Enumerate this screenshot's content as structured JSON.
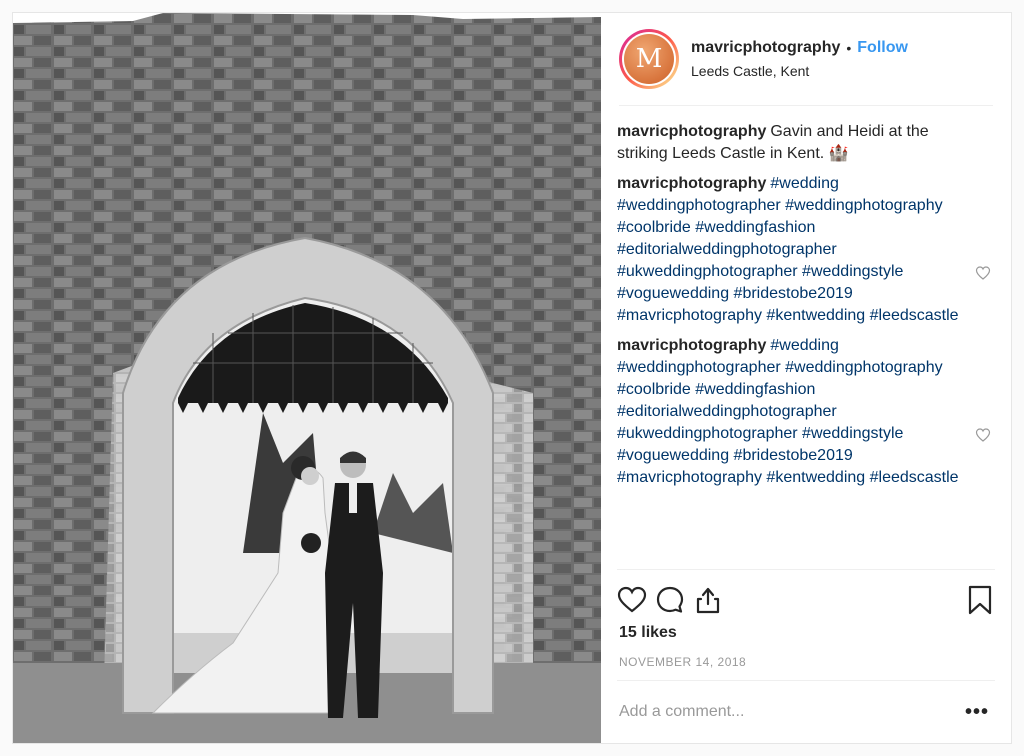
{
  "post": {
    "username": "mavricphotography",
    "separator": "•",
    "follow_label": "Follow",
    "location": "Leeds Castle, Kent",
    "avatar_letter": "M",
    "image_alt": "Black and white wedding photo of bride and groom beneath a stone archway with portcullis"
  },
  "comments": [
    {
      "user": "mavricphotography",
      "text": "Gavin and Heidi at the striking Leeds Castle in Kent. 🏰",
      "tags": []
    },
    {
      "user": "mavricphotography",
      "text": "",
      "tags": [
        "#wedding",
        "#weddingphotographer",
        "#weddingphotography",
        "#coolbride",
        "#weddingfashion",
        "#editorialweddingphotographer",
        "#ukweddingphotographer",
        "#weddingstyle",
        "#voguewedding",
        "#bridestobe2019",
        "#mavricphotography",
        "#kentwedding",
        "#leedscastle"
      ]
    },
    {
      "user": "mavricphotography",
      "text": "",
      "tags": [
        "#wedding",
        "#weddingphotographer",
        "#weddingphotography",
        "#coolbride",
        "#weddingfashion",
        "#editorialweddingphotographer",
        "#ukweddingphotographer",
        "#weddingstyle",
        "#voguewedding",
        "#bridestobe2019",
        "#mavricphotography",
        "#kentwedding",
        "#leedscastle"
      ]
    }
  ],
  "actions": {
    "like_icon": "heart-icon",
    "comment_icon": "comment-icon",
    "share_icon": "share-icon",
    "save_icon": "bookmark-icon"
  },
  "likes_text": "15 likes",
  "date_text": "NOVEMBER 14, 2018",
  "add_comment_placeholder": "Add a comment...",
  "more_label": "•••"
}
